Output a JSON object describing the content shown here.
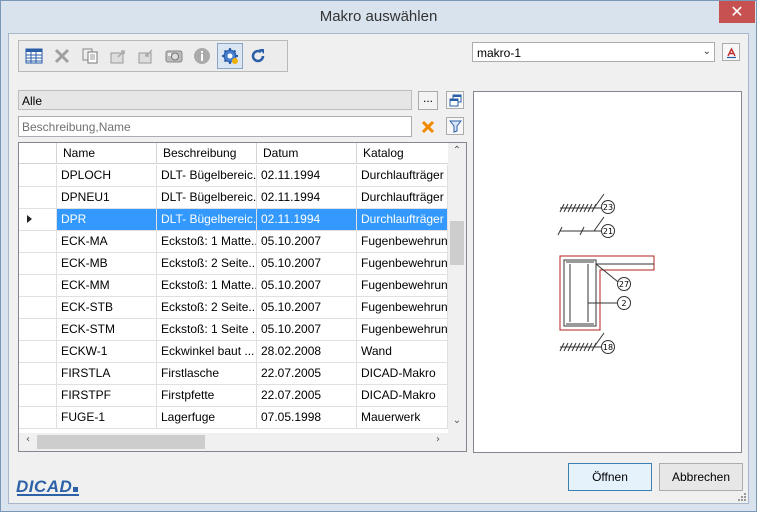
{
  "window": {
    "title": "Makro auswählen",
    "close_glyph": "✕"
  },
  "toolbar": {
    "buttons": [
      {
        "icon": "table-icon",
        "label": ""
      },
      {
        "icon": "delete-icon",
        "label": ""
      },
      {
        "icon": "copy-icon",
        "label": ""
      },
      {
        "icon": "export-icon",
        "label": ""
      },
      {
        "icon": "import-icon",
        "label": ""
      },
      {
        "icon": "camera-icon",
        "label": ""
      },
      {
        "icon": "info-icon",
        "label": ""
      },
      {
        "icon": "settings-icon",
        "label": ""
      },
      {
        "icon": "refresh-icon",
        "label": ""
      }
    ]
  },
  "macro_select": {
    "value": "makro-1",
    "arrow": "⌄"
  },
  "catalog": {
    "value": "Alle",
    "browse_label": "..."
  },
  "filter": {
    "placeholder": "Beschreibung,Name",
    "value": ""
  },
  "grid": {
    "columns": [
      "Name",
      "Beschreibung",
      "Datum",
      "Katalog"
    ],
    "rows": [
      {
        "name": "DPLOCH",
        "desc": "DLT- Bügelbereic...",
        "date": "02.11.1994",
        "catalog": "Durchlaufträger",
        "selected": false
      },
      {
        "name": "DPNEU1",
        "desc": "DLT- Bügelbereic...",
        "date": "02.11.1994",
        "catalog": "Durchlaufträger",
        "selected": false
      },
      {
        "name": "DPR",
        "desc": "DLT- Bügelbereic...",
        "date": "02.11.1994",
        "catalog": "Durchlaufträger",
        "selected": true
      },
      {
        "name": "ECK-MA",
        "desc": "Eckstoß: 1 Matte...",
        "date": "05.10.2007",
        "catalog": "Fugenbewehrung",
        "selected": false
      },
      {
        "name": "ECK-MB",
        "desc": "Eckstoß: 2 Seite...",
        "date": "05.10.2007",
        "catalog": "Fugenbewehrung",
        "selected": false
      },
      {
        "name": "ECK-MM",
        "desc": "Eckstoß: 1 Matte...",
        "date": "05.10.2007",
        "catalog": "Fugenbewehrung",
        "selected": false
      },
      {
        "name": "ECK-STB",
        "desc": "Eckstoß: 2 Seite...",
        "date": "05.10.2007",
        "catalog": "Fugenbewehrung",
        "selected": false
      },
      {
        "name": "ECK-STM",
        "desc": "Eckstoß: 1 Seite ...",
        "date": "05.10.2007",
        "catalog": "Fugenbewehrung",
        "selected": false
      },
      {
        "name": "ECKW-1",
        "desc": "Eckwinkel baut ...",
        "date": "28.02.2008",
        "catalog": "Wand",
        "selected": false
      },
      {
        "name": "FIRSTLA",
        "desc": "Firstlasche",
        "date": "22.07.2005",
        "catalog": "DICAD-Makro",
        "selected": false
      },
      {
        "name": "FIRSTPF",
        "desc": "Firstpfette",
        "date": "22.07.2005",
        "catalog": "DICAD-Makro",
        "selected": false
      },
      {
        "name": "FUGE-1",
        "desc": "Lagerfuge",
        "date": "07.05.1998",
        "catalog": "Mauerwerk",
        "selected": false
      }
    ]
  },
  "preview": {
    "labels": [
      "23",
      "21",
      "27",
      "2",
      "18"
    ]
  },
  "footer": {
    "logo": "DICAD",
    "open_label": "Öffnen",
    "cancel_label": "Abbrechen"
  },
  "colors": {
    "selection": "#3399ff",
    "accent": "#2d62a8",
    "close": "#c75050",
    "drawing_red": "#b22222"
  }
}
